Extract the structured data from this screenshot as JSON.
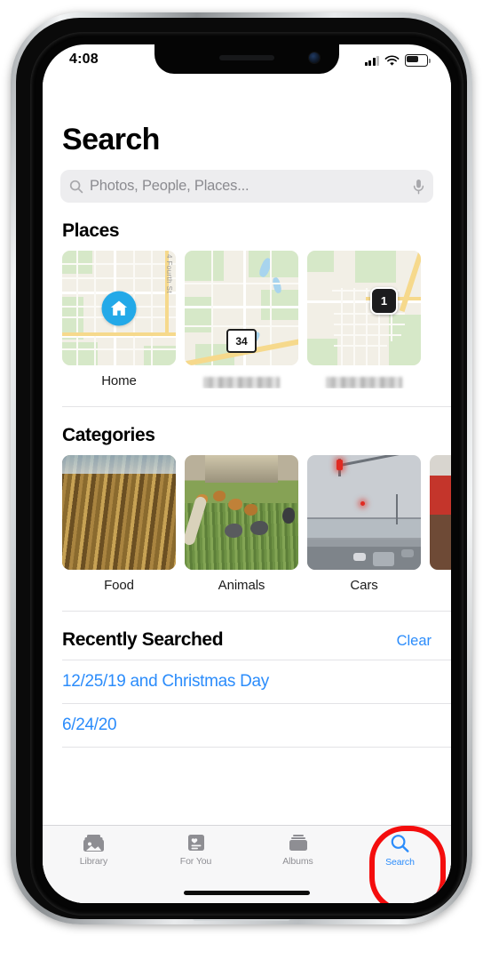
{
  "status_bar": {
    "time": "4:08",
    "signal_icon": "cellular-bars-icon",
    "wifi_icon": "wifi-icon",
    "battery_icon": "battery-icon",
    "battery_level_pct": 62
  },
  "header": {
    "title": "Search"
  },
  "search": {
    "placeholder": "Photos, People, Places...",
    "value": "",
    "search_icon": "magnifier-icon",
    "mic_icon": "microphone-icon"
  },
  "places": {
    "title": "Places",
    "items": [
      {
        "label": "Home",
        "redacted": false,
        "map_street_label": "4 Fourth St",
        "marker": "home-pin"
      },
      {
        "label": "",
        "redacted": true,
        "map_street_label": "",
        "marker": "highway-shield",
        "shield_number": "34"
      },
      {
        "label": "",
        "redacted": true,
        "map_street_label": "",
        "marker": "count-badge",
        "count": "1"
      }
    ]
  },
  "categories": {
    "title": "Categories",
    "items": [
      {
        "label": "Food",
        "image": "corn-field-photo"
      },
      {
        "label": "Animals",
        "image": "chickens-in-yard-photo"
      },
      {
        "label": "Cars",
        "image": "street-traffic-light-photo"
      },
      {
        "label": "",
        "image": "partial-red-photo"
      }
    ]
  },
  "recently_searched": {
    "title": "Recently Searched",
    "clear_label": "Clear",
    "items": [
      "12/25/19 and Christmas Day",
      "6/24/20"
    ]
  },
  "tab_bar": {
    "tabs": [
      {
        "label": "Library",
        "icon": "photo-stack-icon",
        "active": false
      },
      {
        "label": "For You",
        "icon": "heart-card-icon",
        "active": false
      },
      {
        "label": "Albums",
        "icon": "albums-folder-icon",
        "active": false
      },
      {
        "label": "Search",
        "icon": "magnifier-icon",
        "active": true
      }
    ]
  },
  "annotation": {
    "highlight_target": "Search",
    "color": "#f40d0d",
    "shape": "oval-outline"
  },
  "colors": {
    "accent_blue": "#2b8cfb",
    "pin_blue": "#23a9e8",
    "annotation_red": "#f40d0d",
    "tab_inactive_gray": "#8e8e93",
    "searchbar_bg": "#ededef"
  }
}
